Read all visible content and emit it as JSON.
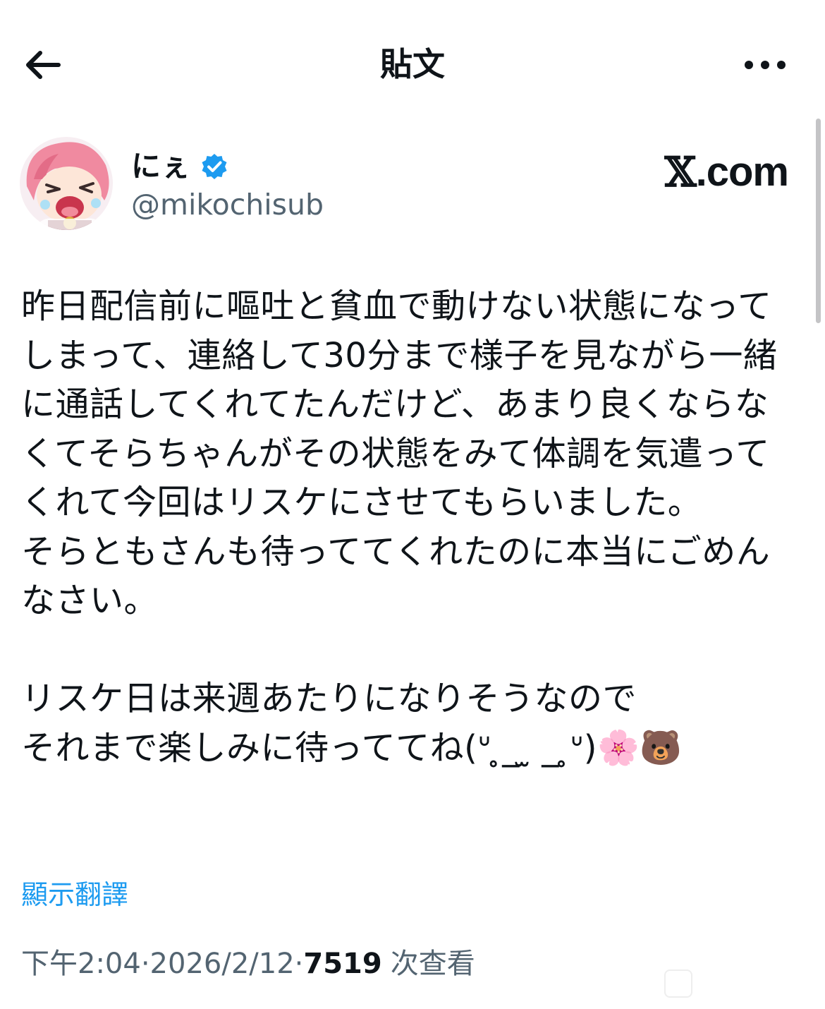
{
  "header": {
    "title": "貼文"
  },
  "author": {
    "name": "にぇ",
    "handle": "@mikochisub",
    "verified": true
  },
  "brand": {
    "label": ".com",
    "x_glyph": "𝕏"
  },
  "tweet": {
    "text": "昨日配信前に嘔吐と貧血で動けない状態になってしまって、連絡して30分まで様子を見ながら一緒に通話してくれてたんだけど、あまり良くならなくてそらちゃんがその状態をみて体調を気遣ってくれて今回はリスケにさせてもらいました。\nそらともさんも待っててくれたのに本当にごめんなさい。\n\nリスケ日は来週あたりになりそうなので\nそれまで楽しみに待っててね(ᐡ ̥_ ̫ _ ̥ᐡ)🌸🐻"
  },
  "translate_label": "顯示翻譯",
  "meta": {
    "time": "下午2:04",
    "separator": " · ",
    "date": "2026/2/12",
    "views_count": "7519",
    "views_label": "次查看"
  },
  "colors": {
    "link": "#1d9bf0",
    "secondary": "#536471",
    "verified": "#1d9bf0",
    "text": "#0f1419"
  },
  "icons": {
    "back": "arrow-left-icon",
    "more": "more-horizontal-icon",
    "verified": "verified-badge-icon"
  }
}
